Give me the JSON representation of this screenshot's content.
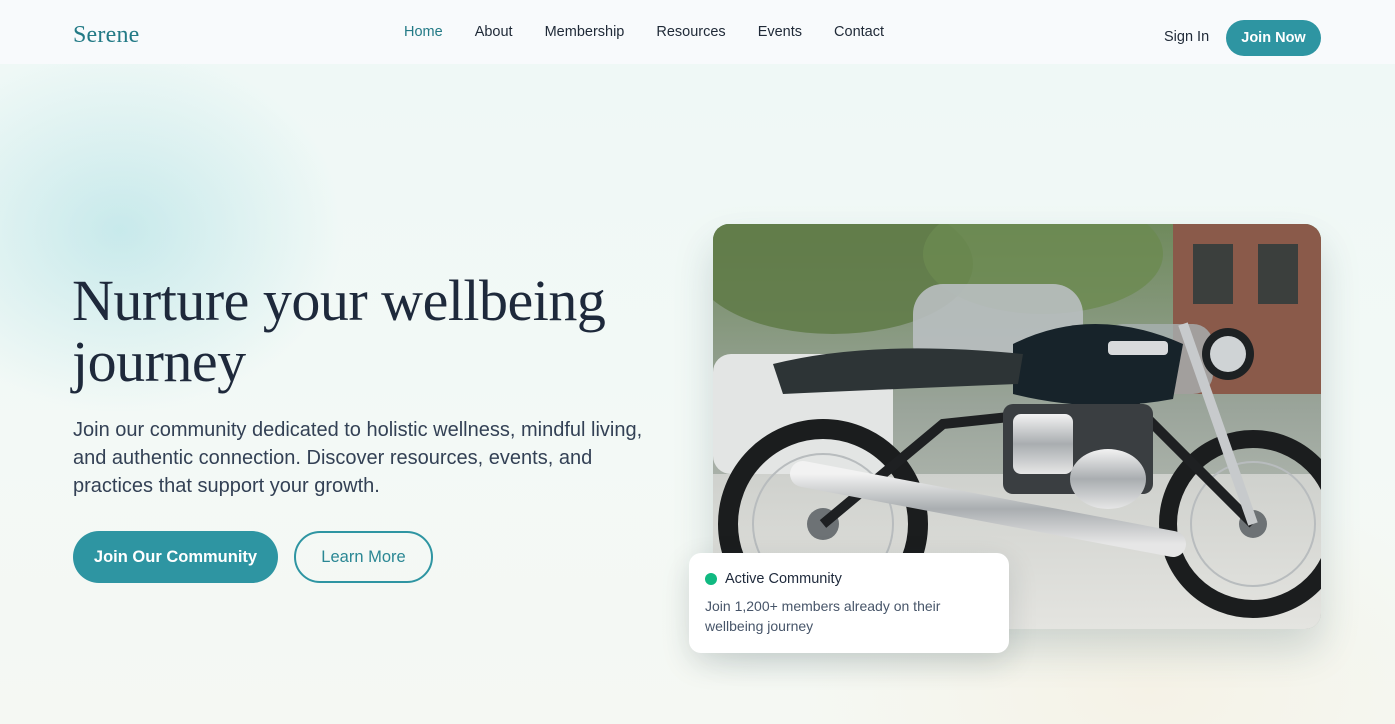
{
  "brand": {
    "logo": "Serene",
    "accent_color": "#2e95a2",
    "status_color": "#10b981"
  },
  "nav": {
    "items": [
      {
        "label": "Home",
        "active": true
      },
      {
        "label": "About",
        "active": false
      },
      {
        "label": "Membership",
        "active": false
      },
      {
        "label": "Resources",
        "active": false
      },
      {
        "label": "Events",
        "active": false
      },
      {
        "label": "Contact",
        "active": false
      }
    ],
    "sign_in_label": "Sign In",
    "join_now_label": "Join Now"
  },
  "hero": {
    "title": "Nurture your wellbeing journey",
    "subtitle": "Join our community dedicated to holistic wellness, mindful living, and authentic connection. Discover resources, events, and practices that support your growth.",
    "primary_button_label": "Join Our Community",
    "secondary_button_label": "Learn More",
    "image_subject": "vintage motorcycle parked on a street"
  },
  "community_card": {
    "status_icon": "green-dot-icon",
    "title": "Active Community",
    "text": "Join 1,200+ members already on their wellbeing journey"
  }
}
